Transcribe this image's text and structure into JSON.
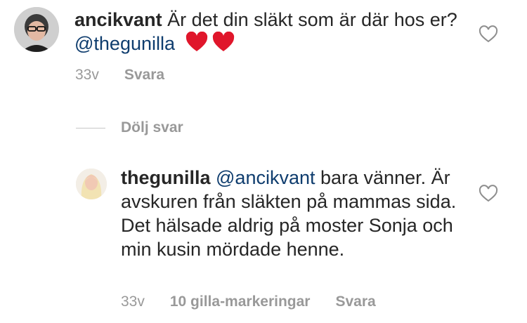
{
  "comments": [
    {
      "username": "ancikvant",
      "text_part1": "Är det din släkt som är där hos er? ",
      "mention": "@thegunilla",
      "text_part2": "",
      "emoji": "❤️❤️",
      "time": "33v",
      "reply_label": "Svara"
    },
    {
      "username": "thegunilla",
      "mention": "@ancikvant",
      "text": " bara vänner. Är avskuren från släkten på mammas sida. Det hälsade aldrig på moster Sonja och min kusin mördade henne.",
      "time": "33v",
      "likes_label": "10 gilla-markeringar",
      "reply_label": "Svara"
    }
  ],
  "hide_replies_label": "Dölj svar",
  "colors": {
    "text": "#262626",
    "meta": "#999999",
    "mention": "#0f3d6e",
    "heart": "#e0162b"
  }
}
